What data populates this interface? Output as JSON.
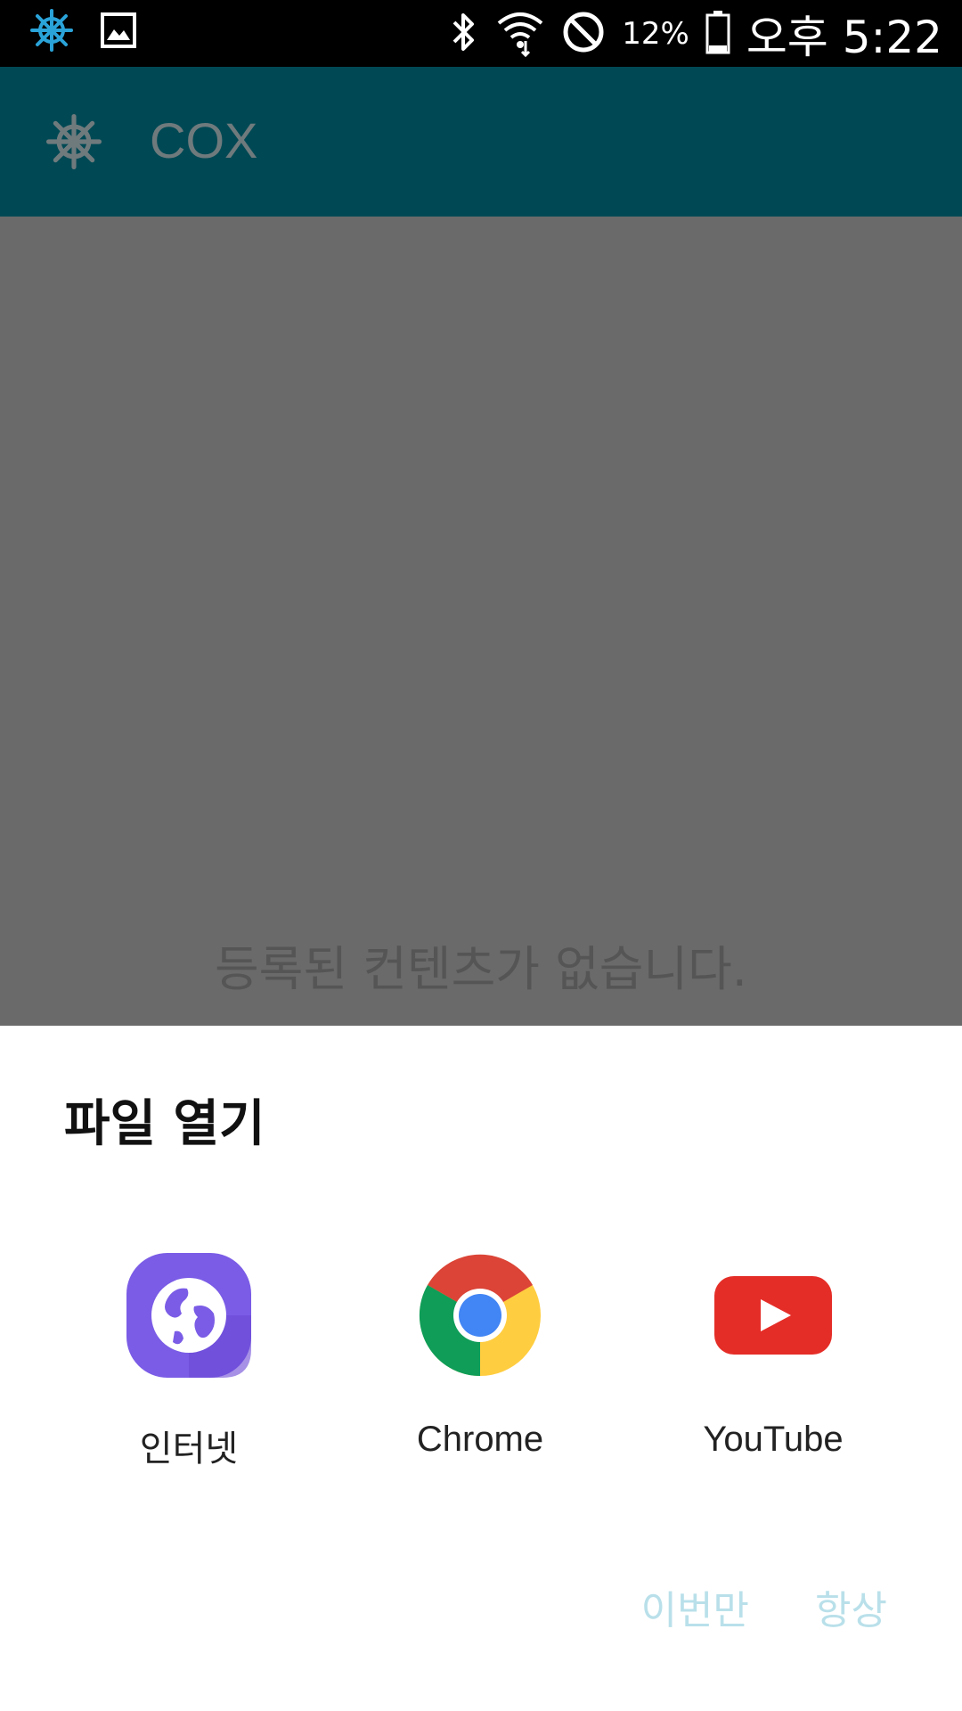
{
  "status_bar": {
    "battery_percent": "12%",
    "time": "오후 5:22",
    "icons": [
      "helm-icon",
      "image-icon",
      "bluetooth-icon",
      "wifi-icon",
      "do-not-disturb-icon",
      "battery-icon"
    ]
  },
  "app_bar": {
    "title": "COX",
    "icon": "helm-icon",
    "color": "#004954"
  },
  "content": {
    "empty_message": "등록된 컨텐츠가 없습니다."
  },
  "dialog": {
    "title": "파일 열기",
    "apps": [
      {
        "label": "인터넷",
        "icon": "samsung-internet-icon"
      },
      {
        "label": "Chrome",
        "icon": "chrome-icon"
      },
      {
        "label": "YouTube",
        "icon": "youtube-icon"
      }
    ],
    "actions": {
      "just_once": "이번만",
      "always": "항상"
    },
    "action_color": "#b9e0ea"
  }
}
